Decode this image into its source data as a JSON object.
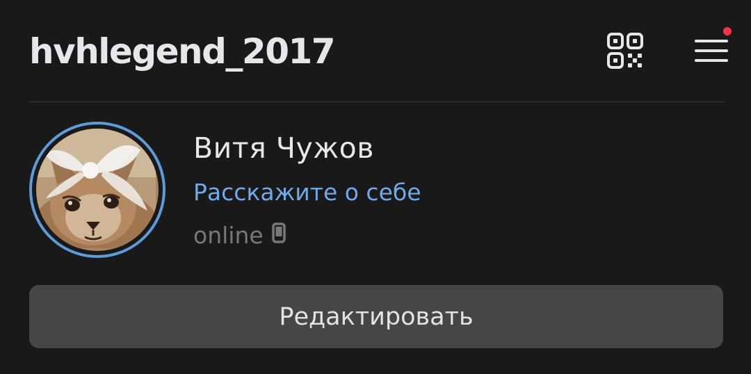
{
  "header": {
    "username": "hvhlegend_2017",
    "qr_icon": "qr-code-icon",
    "menu_icon": "hamburger-menu-icon",
    "menu_has_notification": true
  },
  "profile": {
    "full_name": "Витя Чужов",
    "about_placeholder": "Расскажите о себе",
    "status": "online",
    "status_icon": "mobile-phone-icon",
    "avatar_description": "caracal-avatar"
  },
  "actions": {
    "edit_label": "Редактировать"
  },
  "colors": {
    "background": "#19191a",
    "accent_link": "#71aaeb",
    "avatar_ring": "#5e9bd9",
    "notification_dot": "#ff3347",
    "button_bg": "#454647",
    "status_text": "#76787a"
  }
}
